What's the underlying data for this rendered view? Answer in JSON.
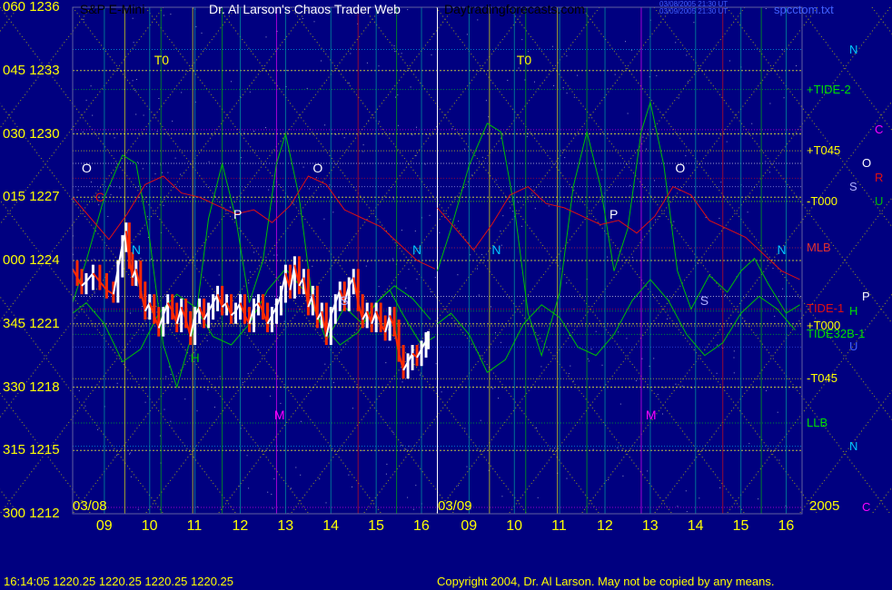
{
  "header": {
    "instrument": "S&P E-Mini",
    "title": "Dr. Al Larson's Chaos Trader Web",
    "site": "Daytradingforecasts.com",
    "file": "spcctom.txt",
    "tiny_line1": "03/08/2005 21:30 UT",
    "tiny_line2": "03/09/2005 21:30 UT"
  },
  "footer": {
    "status": "16:14:05  1220.25 1220.25 1220.25 1220.25",
    "copyright": "Copyright 2004, Dr. Al Larson. May not be copied by any means."
  },
  "colors": {
    "background": "#000080",
    "axis_text": "#ffff00",
    "price_up": "#ffffff",
    "price_down": "#ff2a00",
    "green_curve": "#00c000",
    "red_curve": "#e01010",
    "grid_yellow": "#c8c800",
    "title_text": "#ffffff",
    "site_text": "#ff00ff"
  },
  "chart_data": {
    "type": "line",
    "title": "Dr. Al Larson's Chaos Trader Web",
    "ylim": [
      1212,
      1236
    ],
    "xlim": [
      8.3,
      16.35
    ],
    "y_ticks": [
      {
        "deg": "060",
        "price": "1236",
        "v": 1236
      },
      {
        "deg": "045",
        "price": "1233",
        "v": 1233
      },
      {
        "deg": "030",
        "price": "1230",
        "v": 1230
      },
      {
        "deg": "015",
        "price": "1227",
        "v": 1227
      },
      {
        "deg": "000",
        "price": "1224",
        "v": 1224
      },
      {
        "deg": "345",
        "price": "1221",
        "v": 1221
      },
      {
        "deg": "330",
        "price": "1218",
        "v": 1218
      },
      {
        "deg": "315",
        "price": "1215",
        "v": 1215
      },
      {
        "deg": "300",
        "price": "1212",
        "v": 1212
      }
    ],
    "x_ticks": [
      "09",
      "10",
      "11",
      "12",
      "13",
      "14",
      "15",
      "16",
      "09",
      "10",
      "11",
      "12",
      "13",
      "14",
      "15",
      "16"
    ],
    "date_labels": [
      "03/08",
      "03/09"
    ],
    "year_label": "2005",
    "time_axis_note": "two trading days 03/08 and 03/09, hours 09-16 each",
    "price_series": {
      "name": "S&P E-Mini",
      "points": [
        [
          8.3,
          1223.6
        ],
        [
          8.4,
          1223.2
        ],
        [
          8.5,
          1222.8
        ],
        [
          8.6,
          1223.0
        ],
        [
          8.75,
          1223.4
        ],
        [
          8.9,
          1223.0
        ],
        [
          9.05,
          1222.6
        ],
        [
          9.2,
          1222.4
        ],
        [
          9.3,
          1223.6
        ],
        [
          9.4,
          1224.8
        ],
        [
          9.48,
          1225.4
        ],
        [
          9.55,
          1224.0
        ],
        [
          9.62,
          1223.2
        ],
        [
          9.7,
          1223.6
        ],
        [
          9.8,
          1222.6
        ],
        [
          9.9,
          1221.6
        ],
        [
          10.0,
          1222.0
        ],
        [
          10.1,
          1221.4
        ],
        [
          10.2,
          1220.8
        ],
        [
          10.3,
          1221.4
        ],
        [
          10.4,
          1222.0
        ],
        [
          10.5,
          1221.6
        ],
        [
          10.6,
          1221.0
        ],
        [
          10.7,
          1221.8
        ],
        [
          10.8,
          1221.2
        ],
        [
          10.9,
          1220.4
        ],
        [
          11.0,
          1221.4
        ],
        [
          11.1,
          1221.8
        ],
        [
          11.2,
          1221.2
        ],
        [
          11.3,
          1221.6
        ],
        [
          11.4,
          1222.0
        ],
        [
          11.5,
          1222.4
        ],
        [
          11.6,
          1221.8
        ],
        [
          11.7,
          1222.0
        ],
        [
          11.8,
          1221.4
        ],
        [
          11.9,
          1221.6
        ],
        [
          12.0,
          1222.0
        ],
        [
          12.1,
          1221.4
        ],
        [
          12.2,
          1221.0
        ],
        [
          12.3,
          1221.8
        ],
        [
          12.4,
          1222.0
        ],
        [
          12.5,
          1221.6
        ],
        [
          12.6,
          1221.0
        ],
        [
          12.7,
          1221.4
        ],
        [
          12.8,
          1221.8
        ],
        [
          12.9,
          1222.4
        ],
        [
          13.0,
          1223.4
        ],
        [
          13.1,
          1222.6
        ],
        [
          13.2,
          1223.8
        ],
        [
          13.3,
          1222.8
        ],
        [
          13.4,
          1223.2
        ],
        [
          13.5,
          1221.8
        ],
        [
          13.6,
          1222.4
        ],
        [
          13.7,
          1221.2
        ],
        [
          13.8,
          1221.6
        ],
        [
          13.9,
          1220.4
        ],
        [
          14.0,
          1221.4
        ],
        [
          14.1,
          1222.0
        ],
        [
          14.2,
          1222.6
        ],
        [
          14.3,
          1222.0
        ],
        [
          14.4,
          1222.8
        ],
        [
          14.5,
          1223.2
        ],
        [
          14.6,
          1222.0
        ],
        [
          14.7,
          1221.2
        ],
        [
          14.8,
          1221.6
        ],
        [
          14.9,
          1221.0
        ],
        [
          15.0,
          1221.6
        ],
        [
          15.1,
          1221.0
        ],
        [
          15.2,
          1220.6
        ],
        [
          15.3,
          1221.4
        ],
        [
          15.4,
          1220.8
        ],
        [
          15.5,
          1219.6
        ],
        [
          15.6,
          1218.8
        ],
        [
          15.7,
          1219.2
        ],
        [
          15.8,
          1219.6
        ],
        [
          15.9,
          1219.4
        ],
        [
          16.0,
          1219.8
        ],
        [
          16.1,
          1220.2
        ],
        [
          16.15,
          1220.25
        ]
      ]
    },
    "series": [
      {
        "points": [
          [
            8.3,
            1222.0
          ],
          [
            8.6,
            1224.0
          ],
          [
            9.0,
            1227.0
          ],
          [
            9.4,
            1229.0
          ],
          [
            9.7,
            1228.6
          ],
          [
            10.0,
            1225.0
          ],
          [
            10.3,
            1220.0
          ],
          [
            10.6,
            1218.0
          ],
          [
            11.0,
            1221.0
          ],
          [
            11.3,
            1226.0
          ],
          [
            11.6,
            1228.6
          ],
          [
            11.9,
            1226.0
          ],
          [
            12.2,
            1222.0
          ],
          [
            12.5,
            1224.0
          ],
          [
            12.8,
            1228.6
          ],
          [
            13.0,
            1230.0
          ],
          [
            13.3,
            1227.0
          ],
          [
            13.6,
            1222.0
          ],
          [
            13.9,
            1220.2
          ],
          [
            14.3,
            1221.8
          ],
          [
            14.7,
            1221.0
          ],
          [
            15.0,
            1222.0
          ],
          [
            15.3,
            1222.6
          ],
          [
            15.6,
            1221.4
          ],
          [
            16.0,
            1220.0
          ],
          [
            16.3,
            1220.4
          ]
        ]
      },
      {
        "points": [
          [
            8.3,
            1221.5
          ],
          [
            8.6,
            1222.0
          ],
          [
            9.0,
            1221.0
          ],
          [
            9.4,
            1219.2
          ],
          [
            9.8,
            1219.8
          ],
          [
            10.2,
            1221.5
          ],
          [
            10.6,
            1222.4
          ],
          [
            11.0,
            1221.8
          ],
          [
            11.4,
            1220.4
          ],
          [
            11.8,
            1220.0
          ],
          [
            12.2,
            1221.0
          ],
          [
            12.6,
            1222.6
          ],
          [
            13.0,
            1223.6
          ],
          [
            13.4,
            1222.6
          ],
          [
            13.8,
            1221.0
          ],
          [
            14.2,
            1220.0
          ],
          [
            14.6,
            1220.6
          ],
          [
            15.0,
            1222.0
          ],
          [
            15.4,
            1222.8
          ],
          [
            15.8,
            1222.2
          ],
          [
            16.2,
            1221.2
          ]
        ]
      },
      {
        "points": [
          [
            8.3,
            1227.0
          ],
          [
            8.7,
            1226.0
          ],
          [
            9.1,
            1225.0
          ],
          [
            9.5,
            1226.2
          ],
          [
            9.9,
            1227.6
          ],
          [
            10.3,
            1228.0
          ],
          [
            10.7,
            1227.2
          ],
          [
            11.1,
            1227.0
          ],
          [
            11.5,
            1226.6
          ],
          [
            11.9,
            1226.2
          ],
          [
            12.3,
            1226.4
          ],
          [
            12.7,
            1225.8
          ],
          [
            13.1,
            1226.6
          ],
          [
            13.5,
            1228.0
          ],
          [
            13.9,
            1227.6
          ],
          [
            14.3,
            1226.4
          ],
          [
            14.7,
            1226.0
          ],
          [
            15.1,
            1225.6
          ],
          [
            15.5,
            1224.8
          ],
          [
            15.9,
            1224.0
          ],
          [
            16.3,
            1223.6
          ]
        ]
      }
    ],
    "right_labels": [
      {
        "text": "N",
        "color": "#00c8ff",
        "v": 1234.0
      },
      {
        "text": "+TIDE-2",
        "color": "#00e000",
        "v": 1232.1
      },
      {
        "text": "C",
        "color": "#ff00ff",
        "v": 1230.2
      },
      {
        "text": "+T045",
        "color": "#ffff00",
        "v": 1229.2
      },
      {
        "text": "O",
        "color": "#ffffff",
        "v": 1228.6
      },
      {
        "text": "R",
        "color": "#e01010",
        "v": 1227.9
      },
      {
        "text": "S",
        "color": "#b0b0ff",
        "v": 1227.5
      },
      {
        "text": "-T000",
        "color": "#ffff00",
        "v": 1226.8
      },
      {
        "text": "U",
        "color": "#00c000",
        "v": 1226.8
      },
      {
        "text": "MLB",
        "color": "#e03030",
        "v": 1224.6
      },
      {
        "text": "P",
        "color": "#ffffff",
        "v": 1222.3
      },
      {
        "text": "TIDE-1",
        "color": "#e01010",
        "v": 1221.7
      },
      {
        "text": "H",
        "color": "#00e000",
        "v": 1221.6
      },
      {
        "text": "+T000",
        "color": "#ffff00",
        "v": 1220.9
      },
      {
        "text": "TIDE32B-1",
        "color": "#00e000",
        "v": 1220.5
      },
      {
        "text": "U",
        "color": "#4060ff",
        "v": 1219.9
      },
      {
        "text": "-T045",
        "color": "#ffff00",
        "v": 1218.4
      },
      {
        "text": "LLB",
        "color": "#00e000",
        "v": 1216.3
      },
      {
        "text": "N",
        "color": "#00c8ff",
        "v": 1215.2
      },
      {
        "text": "C",
        "color": "#ff00ff",
        "v": 1212.3
      }
    ],
    "annotations": [
      {
        "text": "T0",
        "color": "#ffff00",
        "x": 10.2,
        "v": 1233.5
      },
      {
        "text": "T0",
        "color": "#ffff00",
        "x": 10.15,
        "v": 1233.5,
        "day": 2
      },
      {
        "text": "O",
        "color": "#ffffff",
        "x": 8.6,
        "v": 1228.4
      },
      {
        "text": "O",
        "color": "#ffffff",
        "x": 13.7,
        "v": 1228.4
      },
      {
        "text": "O",
        "color": "#ffffff",
        "x": 13.65,
        "v": 1228.4,
        "day": 2
      },
      {
        "text": "C",
        "color": "#e01010",
        "x": 8.9,
        "v": 1227.0
      },
      {
        "text": "P",
        "color": "#ffffff",
        "x": 11.95,
        "v": 1226.2
      },
      {
        "text": "P",
        "color": "#ffffff",
        "x": 12.2,
        "v": 1226.2,
        "day": 2
      },
      {
        "text": "N",
        "color": "#00c8ff",
        "x": 9.7,
        "v": 1224.5
      },
      {
        "text": "N",
        "color": "#00c8ff",
        "x": 15.9,
        "v": 1224.5
      },
      {
        "text": "N",
        "color": "#00c8ff",
        "x": 9.6,
        "v": 1224.5,
        "day": 2
      },
      {
        "text": "N",
        "color": "#00c8ff",
        "x": 15.9,
        "v": 1224.5,
        "day": 2
      },
      {
        "text": "S",
        "color": "#b0b0ff",
        "x": 14.3,
        "v": 1222.1
      },
      {
        "text": "S",
        "color": "#b0b0ff",
        "x": 14.2,
        "v": 1222.1,
        "day": 2
      },
      {
        "text": "H",
        "color": "#00c000",
        "x": 11.0,
        "v": 1219.4
      },
      {
        "text": "M",
        "color": "#ff00ff",
        "x": 12.85,
        "v": 1216.7
      },
      {
        "text": "M",
        "color": "#ff00ff",
        "x": 13.0,
        "v": 1216.7,
        "day": 2
      }
    ]
  }
}
